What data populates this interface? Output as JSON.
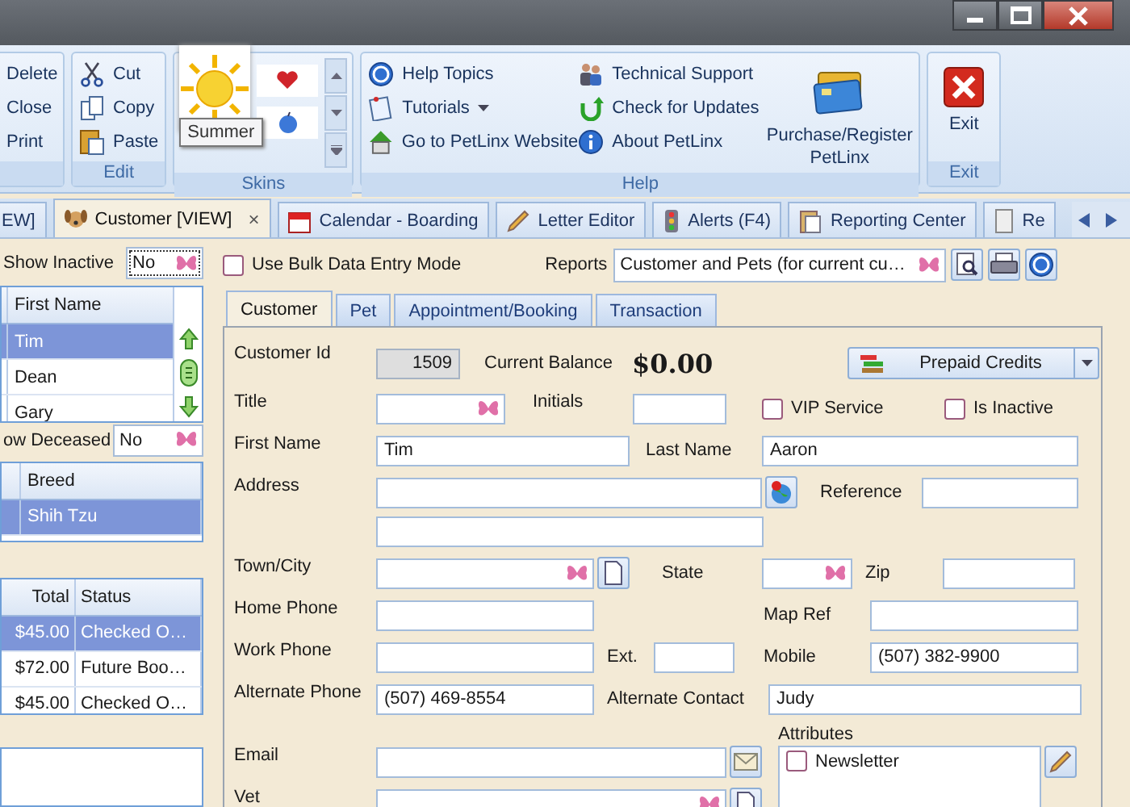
{
  "ribbon": {
    "groups": [
      {
        "kind": "list",
        "items": [
          {
            "label": "Delete"
          },
          {
            "label": "Close"
          },
          {
            "label": "Print"
          }
        ]
      },
      {
        "kind": "list",
        "label": "Edit",
        "items": [
          {
            "label": "Cut"
          },
          {
            "label": "Copy"
          },
          {
            "label": "Paste"
          }
        ]
      },
      {
        "kind": "skins",
        "label": "Skins",
        "tooltip": "Summer"
      },
      {
        "kind": "help",
        "label": "Help",
        "columns": [
          [
            {
              "label": "Help Topics",
              "has_menu": false
            },
            {
              "label": "Tutorials",
              "has_menu": true
            },
            {
              "label": "Go to PetLinx Website",
              "has_menu": false
            }
          ],
          [
            {
              "label": "Technical Support",
              "has_menu": false
            },
            {
              "label": "Check for Updates",
              "has_menu": false
            },
            {
              "label": "About PetLinx",
              "has_menu": false
            }
          ]
        ],
        "big_button": "Purchase/Register PetLinx"
      },
      {
        "kind": "exit",
        "label": "Exit",
        "big_button": "Exit"
      }
    ]
  },
  "doc_tabs": [
    {
      "label": "EW]",
      "selected": false
    },
    {
      "label": "Customer [VIEW]",
      "selected": true,
      "close": "×"
    },
    {
      "label": "Calendar - Boarding",
      "selected": false
    },
    {
      "label": "Letter Editor",
      "selected": false
    },
    {
      "label": "Alerts (F4)",
      "selected": false
    },
    {
      "label": "Reporting Center",
      "selected": false
    },
    {
      "label": "Re",
      "selected": false
    }
  ],
  "left_panel": {
    "show_inactive": {
      "label": "Show Inactive",
      "value": "No"
    },
    "customers": {
      "columns": [
        "First Name"
      ],
      "rows": [
        {
          "cells": [
            "Tim"
          ],
          "selected": true
        },
        {
          "cells": [
            "Dean"
          ],
          "selected": false
        },
        {
          "cells": [
            "Gary"
          ],
          "selected": false
        }
      ]
    },
    "show_deceased": {
      "label": "ow Deceased",
      "value": "No"
    },
    "pets": {
      "columns": [
        "Breed"
      ],
      "rows": [
        {
          "cells": [
            "Shih Tzu"
          ],
          "selected": true
        }
      ]
    },
    "bookings": {
      "columns": [
        "Total",
        "Status"
      ],
      "rows": [
        {
          "cells": [
            "$45.00",
            "Checked O…"
          ],
          "selected": true
        },
        {
          "cells": [
            "$72.00",
            "Future Boo…"
          ],
          "selected": false
        },
        {
          "cells": [
            "$45.00",
            "Checked O…"
          ],
          "selected": false
        }
      ]
    }
  },
  "bulk_entry": {
    "label": "Use Bulk Data Entry Mode",
    "checked": false
  },
  "reports": {
    "label": "Reports",
    "value": "Customer and Pets (for current cu…"
  },
  "form_tabs": [
    {
      "label": "Customer",
      "selected": true
    },
    {
      "label": "Pet",
      "selected": false
    },
    {
      "label": "Appointment/Booking",
      "selected": false
    },
    {
      "label": "Transaction",
      "selected": false
    }
  ],
  "form": {
    "customer_id": {
      "label": "Customer Id",
      "value": "1509"
    },
    "current_balance": {
      "label": "Current Balance",
      "value": "$0.00"
    },
    "prepaid_credits": {
      "label": "Prepaid Credits"
    },
    "title": {
      "label": "Title"
    },
    "initials": {
      "label": "Initials"
    },
    "vip_service": {
      "label": "VIP Service",
      "checked": false
    },
    "is_inactive": {
      "label": "Is Inactive",
      "checked": false
    },
    "first_name": {
      "label": "First Name",
      "value": "Tim"
    },
    "last_name": {
      "label": "Last Name",
      "value": "Aaron"
    },
    "address": {
      "label": "Address"
    },
    "reference": {
      "label": "Reference"
    },
    "town_city": {
      "label": "Town/City"
    },
    "state": {
      "label": "State"
    },
    "zip": {
      "label": "Zip"
    },
    "home_phone": {
      "label": "Home Phone"
    },
    "map_ref": {
      "label": "Map Ref"
    },
    "work_phone": {
      "label": "Work Phone"
    },
    "ext": {
      "label": "Ext."
    },
    "mobile": {
      "label": "Mobile",
      "value": "(507) 382-9900"
    },
    "alternate_phone": {
      "label": "Alternate Phone",
      "value": "(507) 469-8554"
    },
    "alternate_contact": {
      "label": "Alternate Contact",
      "value": "Judy"
    },
    "email": {
      "label": "Email"
    },
    "attributes": {
      "label": "Attributes",
      "items": [
        {
          "label": "Newsletter",
          "checked": false
        }
      ]
    },
    "vet": {
      "label": "Vet"
    }
  }
}
